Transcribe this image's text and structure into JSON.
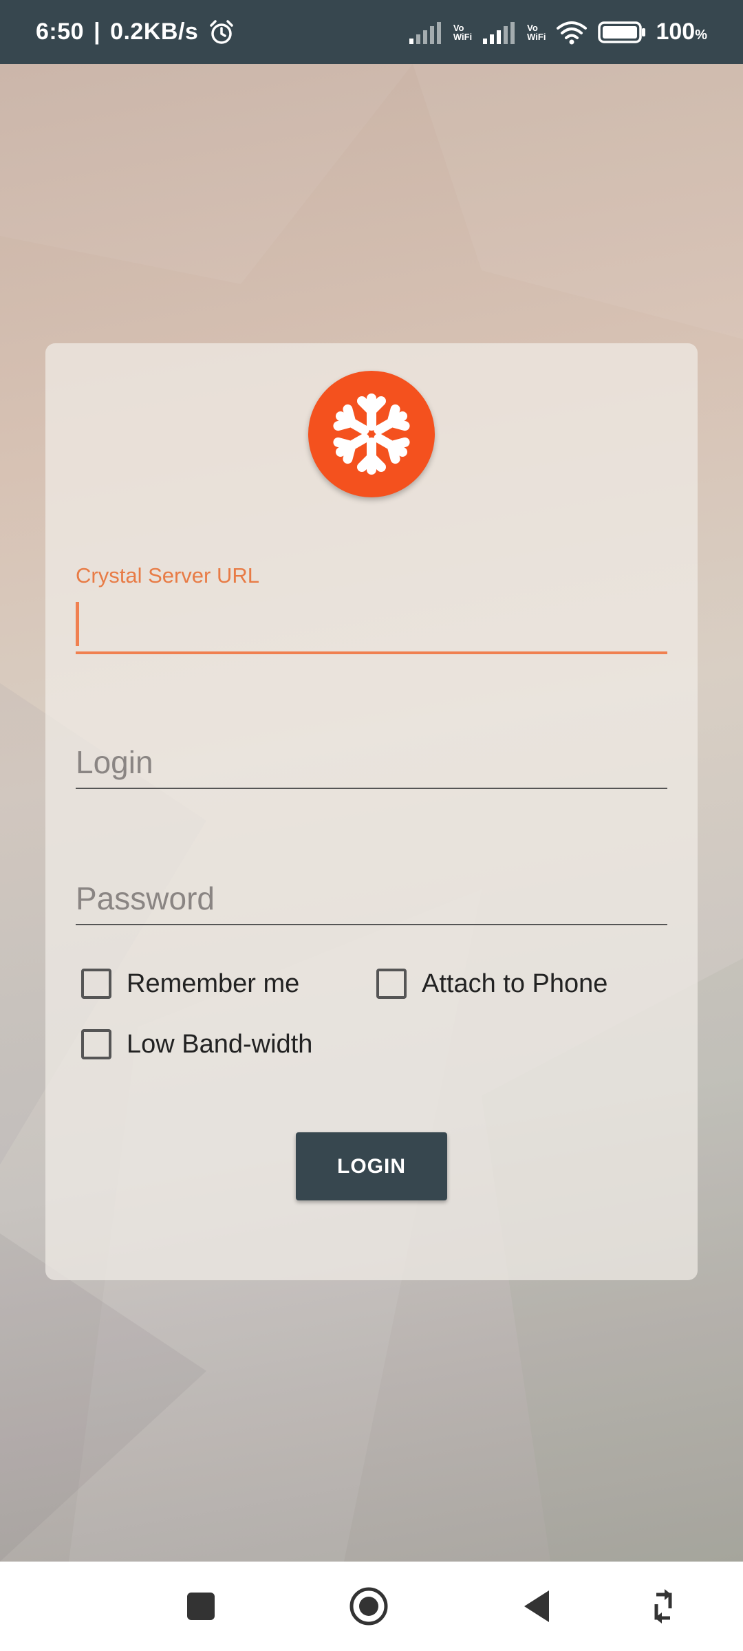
{
  "status_bar": {
    "time": "6:50",
    "network_speed": "0.2KB/s",
    "sim1_label_top": "Vo",
    "sim1_label_bottom": "WiFi",
    "sim2_label_top": "Vo",
    "sim2_label_bottom": "WiFi",
    "battery_percent": "100",
    "battery_unit": "%",
    "icons": [
      "alarm-icon",
      "signal-icon",
      "signal-icon",
      "wifi-icon",
      "battery-icon"
    ]
  },
  "login_form": {
    "logo_icon": "snowflake-icon",
    "server_url": {
      "label": "Crystal Server URL",
      "value": ""
    },
    "login": {
      "placeholder": "Login",
      "value": ""
    },
    "password": {
      "placeholder": "Password",
      "value": ""
    },
    "checkboxes": [
      {
        "label": "Remember me",
        "checked": false
      },
      {
        "label": "Attach to Phone",
        "checked": false
      },
      {
        "label": "Low Band-width",
        "checked": false
      }
    ],
    "login_button": "LOGIN"
  },
  "nav_bar": {
    "items": [
      "recent-apps-icon",
      "home-icon",
      "back-icon",
      "rotate-icon"
    ]
  },
  "colors": {
    "accent": "#f08050",
    "brand": "#f4511e",
    "dark": "#37474f"
  }
}
